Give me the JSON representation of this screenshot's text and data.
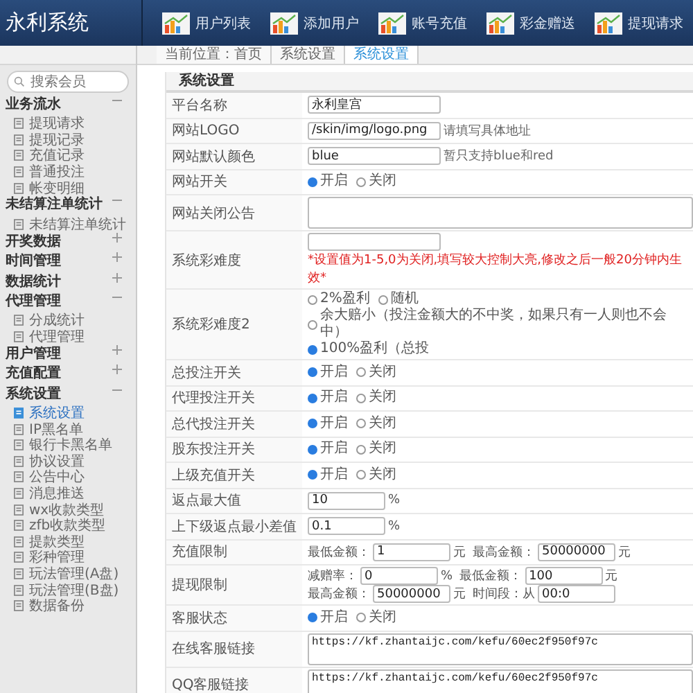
{
  "header": {
    "title": "永利系统",
    "nav": [
      {
        "label": "用户列表"
      },
      {
        "label": "添加用户"
      },
      {
        "label": "账号充值"
      },
      {
        "label": "彩金赠送"
      },
      {
        "label": "提现请求"
      }
    ]
  },
  "breadcrumb": [
    {
      "label": "当前位置：首页",
      "selected": false
    },
    {
      "label": "系统设置",
      "selected": false
    },
    {
      "label": "系统设置",
      "selected": true
    }
  ],
  "sidebar": {
    "search": {
      "placeholder": "搜索会员"
    },
    "groups": [
      {
        "label": "业务流水",
        "expanded": true,
        "items": [
          {
            "label": "提现请求",
            "selected": false
          },
          {
            "label": "提现记录",
            "selected": false
          },
          {
            "label": "充值记录",
            "selected": false
          },
          {
            "label": "普通投注",
            "selected": false
          },
          {
            "label": "帐变明细",
            "selected": false
          }
        ]
      },
      {
        "label": "未结算注单统计",
        "expanded": true,
        "items": [
          {
            "label": "未结算注单统计",
            "selected": false
          }
        ]
      },
      {
        "label": "开奖数据",
        "expanded": false
      },
      {
        "label": "时间管理",
        "expanded": false
      },
      {
        "label": "数据统计",
        "expanded": false
      },
      {
        "label": "代理管理",
        "expanded": true,
        "items": [
          {
            "label": "分成统计",
            "selected": false
          },
          {
            "label": "代理管理",
            "selected": false
          }
        ]
      },
      {
        "label": "用户管理",
        "expanded": false
      },
      {
        "label": "充值配置",
        "expanded": false
      },
      {
        "label": "系统设置",
        "expanded": true,
        "items": [
          {
            "label": "系统设置",
            "selected": true
          },
          {
            "label": "IP黑名单",
            "selected": false
          },
          {
            "label": "银行卡黑名单",
            "selected": false
          },
          {
            "label": "协议设置",
            "selected": false
          },
          {
            "label": "公告中心",
            "selected": false
          },
          {
            "label": "消息推送",
            "selected": false
          },
          {
            "label": "wx收款类型",
            "selected": false
          },
          {
            "label": "zfb收款类型",
            "selected": false
          },
          {
            "label": "提款类型",
            "selected": false
          },
          {
            "label": "彩种管理",
            "selected": false
          },
          {
            "label": "玩法管理(A盘)",
            "selected": false
          },
          {
            "label": "玩法管理(B盘)",
            "selected": false
          },
          {
            "label": "数据备份",
            "selected": false
          }
        ]
      }
    ]
  },
  "form": {
    "title": "系统设置",
    "rows": [
      {
        "kind": "text",
        "label": "平台名称",
        "value": "永利皇宫"
      },
      {
        "kind": "text",
        "label": "网站LOGO",
        "value": "/skin/img/logo.png",
        "note": {
          "text": "请填写具体地址",
          "alert": false
        }
      },
      {
        "kind": "text",
        "label": "网站默认颜色",
        "value": "blue",
        "note": {
          "text": "暂只支持blue和red",
          "alert": false
        }
      },
      {
        "kind": "radio",
        "label": "网站开关",
        "options": [
          {
            "label": "开启",
            "selected": true
          },
          {
            "label": "关闭",
            "selected": false
          }
        ]
      },
      {
        "kind": "textarea",
        "label": "网站关闭公告"
      },
      {
        "kind": "text",
        "label": "系统彩难度",
        "note": {
          "text": "*设置值为1-5,0为关闭,填写较大控制大亮,修改之后一般20分钟内生效*",
          "alert": true
        }
      },
      {
        "kind": "radio",
        "label": "系统彩难度2",
        "options": [
          {
            "label": "2%盈利",
            "selected": false
          },
          {
            "label": "随机",
            "selected": false
          },
          {
            "label": "余大赔小（投注金额大的不中奖，如果只有一人则也不会中）",
            "selected": false
          },
          {
            "label": "100%盈利（总投",
            "selected": true
          }
        ]
      },
      {
        "kind": "radio",
        "label": "总投注开关",
        "options": [
          {
            "label": "开启",
            "selected": true
          },
          {
            "label": "关闭",
            "selected": false
          }
        ]
      },
      {
        "kind": "radio",
        "label": "代理投注开关",
        "options": [
          {
            "label": "开启",
            "selected": true
          },
          {
            "label": "关闭",
            "selected": false
          }
        ]
      },
      {
        "kind": "radio",
        "label": "总代投注开关",
        "options": [
          {
            "label": "开启",
            "selected": true
          },
          {
            "label": "关闭",
            "selected": false
          }
        ]
      },
      {
        "kind": "radio",
        "label": "股东投注开关",
        "options": [
          {
            "label": "开启",
            "selected": true
          },
          {
            "label": "关闭",
            "selected": false
          }
        ]
      },
      {
        "kind": "radio",
        "label": "上级充值开关",
        "options": [
          {
            "label": "开启",
            "selected": true
          },
          {
            "label": "关闭",
            "selected": false
          }
        ]
      },
      {
        "kind": "fields",
        "label": "返点最大值",
        "parts": [
          {
            "value": "10",
            "unit": "%"
          }
        ]
      },
      {
        "kind": "fields",
        "label": "上下级返点最小差值",
        "parts": [
          {
            "value": "0.1",
            "unit": "%"
          }
        ]
      },
      {
        "kind": "fields",
        "label": "充值限制",
        "parts": [
          {
            "label": "最低金额：",
            "value": "1",
            "unit": "元"
          },
          {
            "label": "最高金额：",
            "value": "50000000",
            "unit": "元"
          }
        ]
      },
      {
        "kind": "fields",
        "label": "提现限制",
        "parts": [
          {
            "label": "减赠率：",
            "value": "0",
            "unit": "%"
          },
          {
            "label": "最低金额：",
            "value": "100",
            "unit": "元"
          },
          {
            "label": "最高金额：",
            "value": "50000000",
            "unit": "元"
          },
          {
            "label": "时间段：从",
            "value": "00:0"
          }
        ]
      },
      {
        "kind": "radio",
        "label": "客服状态",
        "options": [
          {
            "label": "开启",
            "selected": true
          },
          {
            "label": "关闭",
            "selected": false
          }
        ]
      },
      {
        "kind": "textarea",
        "label": "在线客服链接",
        "value": "https://kf.zhantaijc.com/kefu/60ec2f950f97c"
      },
      {
        "kind": "textarea",
        "label": "QQ客服链接",
        "value": "https://kf.zhantaijc.com/kefu/60ec2f950f97c"
      }
    ]
  }
}
